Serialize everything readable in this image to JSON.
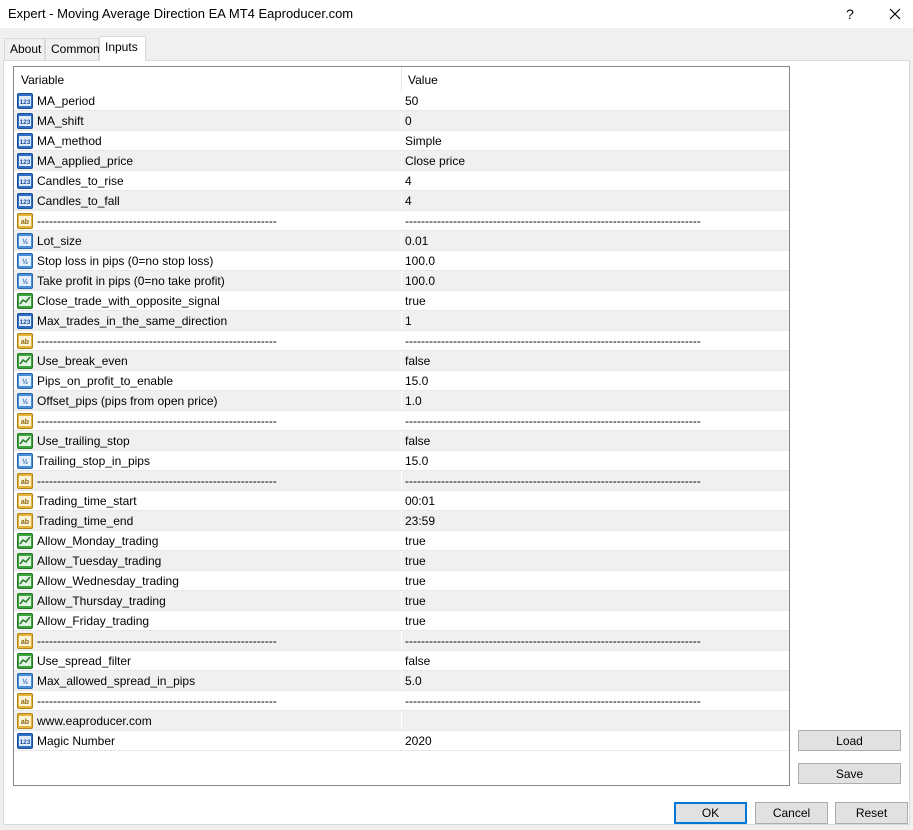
{
  "window": {
    "title": "Expert - Moving Average Direction EA MT4 Eaproducer.com",
    "help_label": "?"
  },
  "tabs": [
    {
      "label": "About"
    },
    {
      "label": "Common"
    },
    {
      "label": "Inputs",
      "active": true
    }
  ],
  "grid": {
    "headers": {
      "variable": "Variable",
      "value": "Value"
    },
    "rows": [
      {
        "icon": "int-icon",
        "variable": "MA_period",
        "value": "50"
      },
      {
        "icon": "int-icon",
        "variable": "MA_shift",
        "value": "0"
      },
      {
        "icon": "int-icon",
        "variable": "MA_method",
        "value": "Simple"
      },
      {
        "icon": "int-icon",
        "variable": "MA_applied_price",
        "value": "Close price"
      },
      {
        "icon": "int-icon",
        "variable": "Candles_to_rise",
        "value": "4"
      },
      {
        "icon": "int-icon",
        "variable": "Candles_to_fall",
        "value": "4"
      },
      {
        "icon": "string-icon",
        "variable": "------------------------------------------------------------",
        "value": "--------------------------------------------------------------------------"
      },
      {
        "icon": "double-icon",
        "variable": "Lot_size",
        "value": "0.01"
      },
      {
        "icon": "double-icon",
        "variable": "Stop loss in pips (0=no stop loss)",
        "value": "100.0"
      },
      {
        "icon": "double-icon",
        "variable": "Take profit in pips (0=no take profit)",
        "value": "100.0"
      },
      {
        "icon": "bool-icon",
        "variable": "Close_trade_with_opposite_signal",
        "value": "true"
      },
      {
        "icon": "int-icon",
        "variable": "Max_trades_in_the_same_direction",
        "value": "1"
      },
      {
        "icon": "string-icon",
        "variable": "------------------------------------------------------------",
        "value": "--------------------------------------------------------------------------"
      },
      {
        "icon": "bool-icon",
        "variable": "Use_break_even",
        "value": "false"
      },
      {
        "icon": "double-icon",
        "variable": "Pips_on_profit_to_enable",
        "value": "15.0"
      },
      {
        "icon": "double-icon",
        "variable": "Offset_pips (pips from open price)",
        "value": "1.0"
      },
      {
        "icon": "string-icon",
        "variable": "------------------------------------------------------------",
        "value": "--------------------------------------------------------------------------"
      },
      {
        "icon": "bool-icon",
        "variable": "Use_trailing_stop",
        "value": "false"
      },
      {
        "icon": "double-icon",
        "variable": "Trailing_stop_in_pips",
        "value": "15.0"
      },
      {
        "icon": "string-icon",
        "variable": "------------------------------------------------------------",
        "value": "--------------------------------------------------------------------------"
      },
      {
        "icon": "string-icon",
        "variable": "Trading_time_start",
        "value": "00:01"
      },
      {
        "icon": "string-icon",
        "variable": "Trading_time_end",
        "value": "23:59"
      },
      {
        "icon": "bool-icon",
        "variable": "Allow_Monday_trading",
        "value": "true"
      },
      {
        "icon": "bool-icon",
        "variable": "Allow_Tuesday_trading",
        "value": "true"
      },
      {
        "icon": "bool-icon",
        "variable": "Allow_Wednesday_trading",
        "value": "true"
      },
      {
        "icon": "bool-icon",
        "variable": "Allow_Thursday_trading",
        "value": "true"
      },
      {
        "icon": "bool-icon",
        "variable": "Allow_Friday_trading",
        "value": "true"
      },
      {
        "icon": "string-icon",
        "variable": "------------------------------------------------------------",
        "value": "--------------------------------------------------------------------------"
      },
      {
        "icon": "bool-icon",
        "variable": "Use_spread_filter",
        "value": "false"
      },
      {
        "icon": "double-icon",
        "variable": "Max_allowed_spread_in_pips",
        "value": "5.0"
      },
      {
        "icon": "string-icon",
        "variable": "------------------------------------------------------------",
        "value": "--------------------------------------------------------------------------"
      },
      {
        "icon": "string-icon",
        "variable": "www.eaproducer.com",
        "value": ""
      },
      {
        "icon": "int-icon",
        "variable": "Magic Number",
        "value": "2020"
      }
    ]
  },
  "side_buttons": {
    "load_label": "Load",
    "save_label": "Save"
  },
  "footer": {
    "ok_label": "OK",
    "cancel_label": "Cancel",
    "reset_label": "Reset"
  },
  "colors": {
    "focus_border": "#0078d7",
    "alt_row": "#f0f0f0",
    "dialog_bg": "#f0f0f0"
  }
}
